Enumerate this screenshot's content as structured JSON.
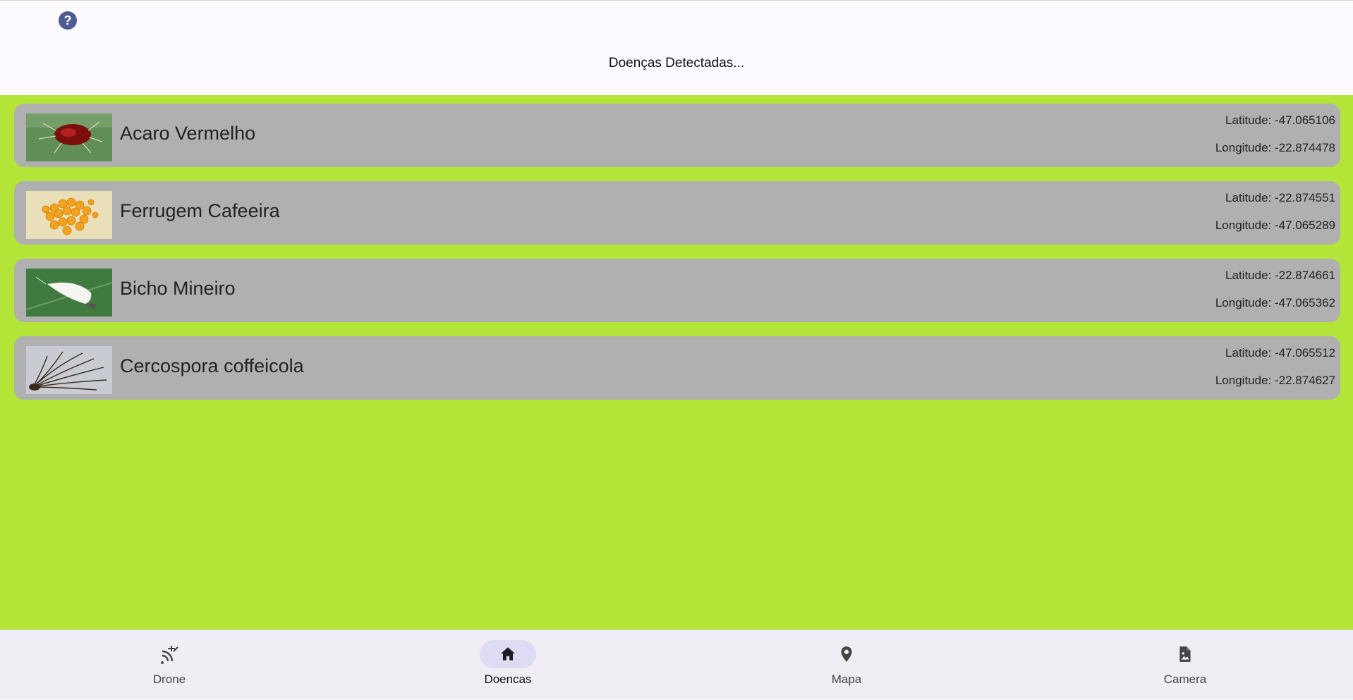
{
  "header": {
    "help_icon": "help-circle-icon",
    "title": "Doenças Detectadas..."
  },
  "detections": [
    {
      "name": "Acaro Vermelho",
      "latitude": "Latitude: -47.065106",
      "longitude": "Longitude: -22.874478",
      "thumbnail": "red-mite-photo"
    },
    {
      "name": "Ferrugem Cafeeira",
      "latitude": "Latitude: -22.874551",
      "longitude": "Longitude: -47.065289",
      "thumbnail": "coffee-rust-spores-photo"
    },
    {
      "name": "Bicho Mineiro",
      "latitude": "Latitude: -22.874661",
      "longitude": "Longitude: -47.065362",
      "thumbnail": "leaf-miner-moth-photo"
    },
    {
      "name": "Cercospora coffeicola",
      "latitude": "Latitude: -47.065512",
      "longitude": "Longitude: -22.874627",
      "thumbnail": "cercospora-fungus-photo"
    }
  ],
  "nav": {
    "items": [
      {
        "label": "Drone",
        "icon": "drone-signal-icon"
      },
      {
        "label": "Doencas",
        "icon": "home-icon",
        "active": true
      },
      {
        "label": "Mapa",
        "icon": "location-pin-icon"
      },
      {
        "label": "Camera",
        "icon": "image-file-icon"
      }
    ]
  },
  "colors": {
    "content_background": "#b2e537",
    "card_background": "#b0b0b0",
    "header_background": "#fcfaff",
    "navbar_background": "#f0edf4",
    "active_pill": "#dedcf5",
    "help_icon": "#4e5a94"
  }
}
